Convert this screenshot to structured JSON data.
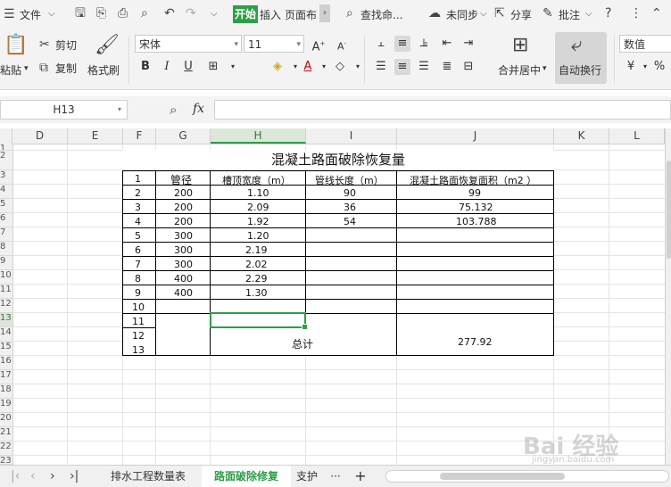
{
  "menu": {
    "file": "文件",
    "start": "开始",
    "insert": "插入",
    "page_layout": "页面布",
    "search": "查找命...",
    "sync": "未同步",
    "share": "分享",
    "comment": "批注"
  },
  "ribbon": {
    "paste": "粘贴",
    "cut": "剪切",
    "copy": "复制",
    "format_painter": "格式刷",
    "font_name": "宋体",
    "font_size": "11",
    "merge_center": "合并居中",
    "wrap_text": "自动换行",
    "number_format": "数值"
  },
  "formula_bar": {
    "name_box": "H13",
    "fx": "fx",
    "value": ""
  },
  "columns": [
    "D",
    "E",
    "F",
    "G",
    "H",
    "I",
    "J",
    "K",
    "L"
  ],
  "rows": [
    "1",
    "2",
    "3",
    "4",
    "5",
    "6",
    "7",
    "8",
    "9",
    "10",
    "11",
    "12",
    "13",
    "14",
    "15",
    "16",
    "17",
    "18",
    "19",
    "20",
    "21",
    "22",
    "23"
  ],
  "sheet": {
    "title": "混凝土路面破除恢复量",
    "headers": [
      "1",
      "管径",
      "槽顶宽度（m）",
      "管线长度（m）",
      "混凝土路面恢复面积（m2 ）"
    ],
    "rows": [
      [
        "2",
        "200",
        "1.10",
        "90",
        "99"
      ],
      [
        "3",
        "200",
        "2.09",
        "36",
        "75.132"
      ],
      [
        "4",
        "200",
        "1.92",
        "54",
        "103.788"
      ],
      [
        "5",
        "300",
        "1.20",
        "",
        ""
      ],
      [
        "6",
        "300",
        "2.19",
        "",
        ""
      ],
      [
        "7",
        "300",
        "2.02",
        "",
        ""
      ],
      [
        "8",
        "400",
        "2.29",
        "",
        ""
      ],
      [
        "9",
        "400",
        "1.30",
        "",
        ""
      ],
      [
        "10",
        "",
        "",
        "",
        ""
      ],
      [
        "11",
        "",
        "",
        "",
        ""
      ]
    ],
    "merged_rows": [
      "12",
      "13"
    ],
    "total_label": "总计",
    "total_value": "277.92"
  },
  "tabs": {
    "sheet1": "排水工程数量表",
    "sheet2": "路面破除修复",
    "sheet3": "支护",
    "more": "···",
    "add": "+"
  },
  "watermark": {
    "text": "Bai 经验",
    "sub": "jingyan.baidu.com"
  },
  "colors": {
    "accent": "#2e9e47"
  }
}
